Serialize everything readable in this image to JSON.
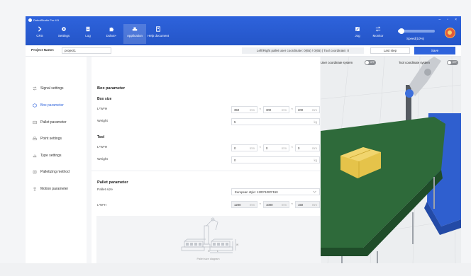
{
  "app": {
    "title": "DobotStudio Pro 4.5"
  },
  "window_controls": {
    "minimize": "–",
    "maximize": "▫",
    "close": "×"
  },
  "nav": [
    {
      "label": "CRS",
      "icon": "crs-icon"
    },
    {
      "label": "Settings",
      "icon": "gear-icon"
    },
    {
      "label": "Log",
      "icon": "log-icon"
    },
    {
      "label": "Dobot+",
      "icon": "puzzle-icon"
    },
    {
      "label": "Application",
      "icon": "application-icon",
      "active": true
    },
    {
      "label": "Help document",
      "icon": "help-document-icon"
    }
  ],
  "right_nav": [
    {
      "label": "Jog",
      "icon": "jog-icon"
    },
    {
      "label": "Monitor",
      "icon": "monitor-icon"
    }
  ],
  "speed": {
    "label": "Speed(10%)",
    "value_percent": 10
  },
  "project": {
    "label": "Project Name:",
    "value": "project1"
  },
  "coord_info": "Left/Right pallet user coordinate: 0(65) / 0(65) | Tool coordinate: 0",
  "buttons": {
    "last_step": "Last step",
    "save": "Save"
  },
  "sidebar": {
    "items": [
      {
        "label": "Signal settings",
        "icon": "signal-icon"
      },
      {
        "label": "Box parameter",
        "icon": "box-icon",
        "active": true
      },
      {
        "label": "Pallet parameter",
        "icon": "pallet-icon"
      },
      {
        "label": "Point settings",
        "icon": "point-icon"
      },
      {
        "label": "Type settings",
        "icon": "type-icon"
      },
      {
        "label": "Palletizing method",
        "icon": "method-icon"
      },
      {
        "label": "Motion parameter",
        "icon": "motion-icon"
      }
    ]
  },
  "box_parameter": {
    "title": "Box parameter",
    "box_size": {
      "title": "Box size",
      "dims_label": "L*W*H",
      "length": "350",
      "width": "300",
      "height": "200",
      "unit": "mm",
      "weight_label": "Weight",
      "weight": "5",
      "weight_unit": "kg"
    },
    "tool": {
      "title": "Tool",
      "dims_label": "L*W*H",
      "length": "0",
      "width": "0",
      "height": "0",
      "unit": "mm",
      "weight_label": "Weight",
      "weight": "0",
      "weight_unit": "kg"
    },
    "times": "*"
  },
  "pallet_parameter": {
    "title": "Pallet parameter",
    "size_label": "Pallet size",
    "size_value": "European style: 1200*1000*150",
    "dims_label": "L*W*H",
    "length": "1200",
    "width": "1000",
    "height": "150",
    "unit": "mm",
    "diagram_caption": "Pallet size diagram",
    "diagram_letters": {
      "h": "H",
      "l": "L",
      "w": "W"
    }
  },
  "view_toggles": [
    {
      "label": "User coordinate system",
      "state": "OFF"
    },
    {
      "label": "Tool coordinate system",
      "state": "OFF"
    }
  ],
  "colors": {
    "accent": "#2e63dc",
    "conveyor": "#2d6a3b",
    "box": "#e5c34a"
  }
}
